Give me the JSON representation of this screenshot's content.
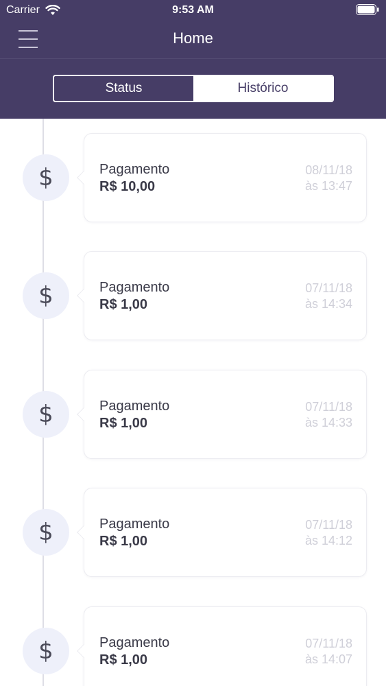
{
  "status_bar": {
    "carrier": "Carrier",
    "time": "9:53 AM"
  },
  "nav": {
    "title": "Home"
  },
  "tabs": [
    {
      "label": "Status",
      "selected": false
    },
    {
      "label": "Histórico",
      "selected": true
    }
  ],
  "colors": {
    "header": "#463d66",
    "icon_circle": "#eef0fa",
    "muted_text": "#cfcfd8"
  },
  "transactions": [
    {
      "type": "Pagamento",
      "amount": "R$ 10,00",
      "date": "08/11/18",
      "time": "às 13:47",
      "icon": "dollar-icon"
    },
    {
      "type": "Pagamento",
      "amount": "R$ 1,00",
      "date": "07/11/18",
      "time": "às 14:34",
      "icon": "dollar-icon"
    },
    {
      "type": "Pagamento",
      "amount": "R$ 1,00",
      "date": "07/11/18",
      "time": "às 14:33",
      "icon": "dollar-icon"
    },
    {
      "type": "Pagamento",
      "amount": "R$ 1,00",
      "date": "07/11/18",
      "time": "às 14:12",
      "icon": "dollar-icon"
    },
    {
      "type": "Pagamento",
      "amount": "R$ 1,00",
      "date": "07/11/18",
      "time": "às 14:07",
      "icon": "dollar-icon"
    }
  ]
}
